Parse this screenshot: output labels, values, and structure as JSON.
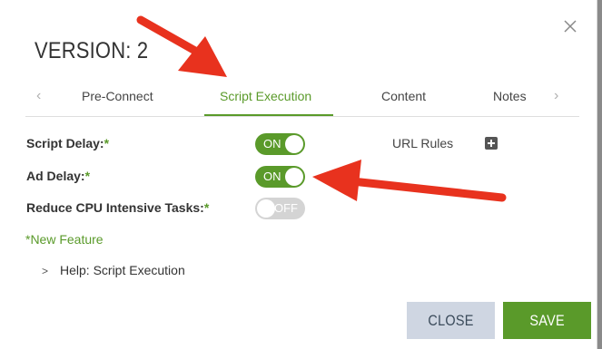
{
  "dialog": {
    "title": "VERSION: 2"
  },
  "tabs": {
    "items": [
      {
        "label": "Pre-Connect"
      },
      {
        "label": "Script Execution",
        "active": true
      },
      {
        "label": "Content"
      },
      {
        "label": "Notes"
      }
    ]
  },
  "settings": [
    {
      "label": "Script Delay:",
      "required_mark": "*",
      "toggle": "ON",
      "state": "on"
    },
    {
      "label": "Ad Delay:",
      "required_mark": "*",
      "toggle": "ON",
      "state": "on"
    },
    {
      "label": "Reduce CPU Intensive Tasks:",
      "required_mark": "*",
      "toggle": "OFF",
      "state": "off"
    }
  ],
  "url_rules": {
    "label": "URL Rules",
    "add_icon": "plus-square-icon"
  },
  "new_feature_note": "*New Feature",
  "help": {
    "label": "Help: Script Execution",
    "icon": "chevron-right-icon"
  },
  "buttons": {
    "close_label": "CLOSE",
    "save_label": "SAVE"
  },
  "colors": {
    "accent": "#5a9a2a",
    "annotation_arrow": "#e8321e",
    "close_button_bg": "#cfd6e2"
  },
  "icons": {
    "close": "close-icon",
    "tab_prev": "chevron-left-icon",
    "tab_next": "chevron-right-icon"
  }
}
